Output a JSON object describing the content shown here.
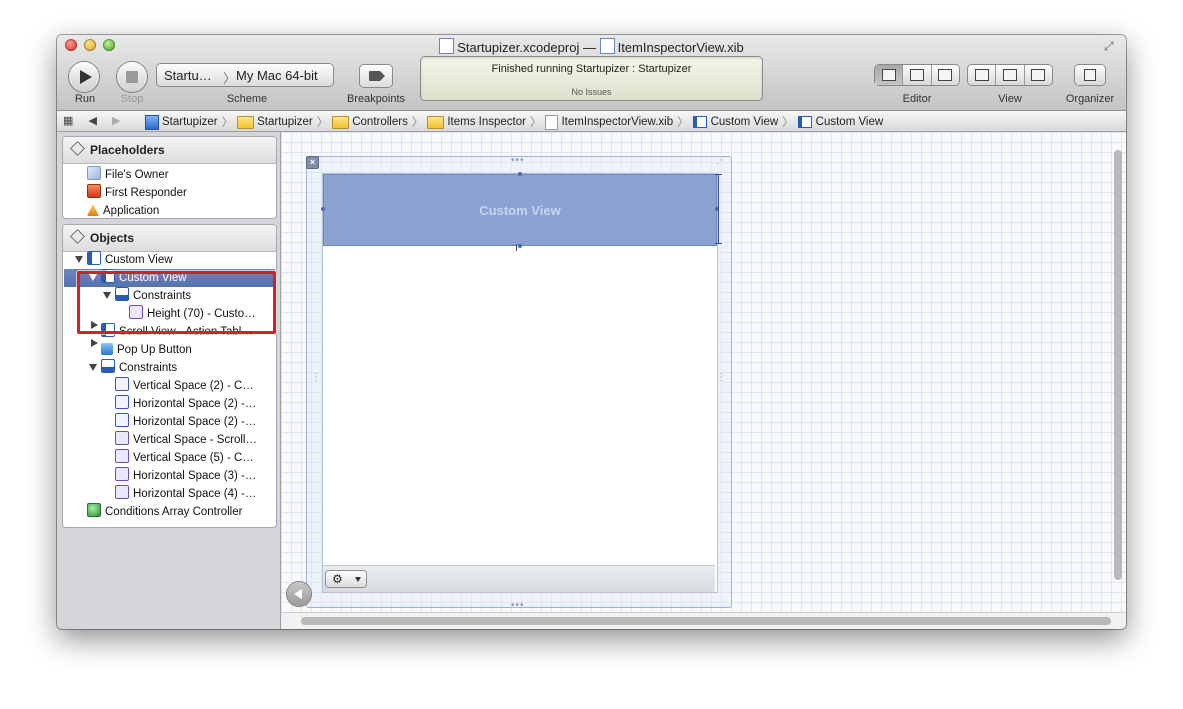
{
  "window": {
    "title_project": "Startupizer.xcodeproj",
    "title_sep": "—",
    "title_file": "ItemInspectorView.xib"
  },
  "toolbar": {
    "run_label": "Run",
    "stop_label": "Stop",
    "scheme_label": "Scheme",
    "scheme_target": "Startu…",
    "scheme_destination": "My Mac 64-bit",
    "breakpoints_label": "Breakpoints",
    "editor_label": "Editor",
    "view_label": "View",
    "organizer_label": "Organizer"
  },
  "activity": {
    "status": "Finished running Startupizer : Startupizer",
    "issues": "No Issues"
  },
  "jumpbar": {
    "items": [
      {
        "label": "Startupizer",
        "icon": "project-icon"
      },
      {
        "label": "Startupizer",
        "icon": "folder-icon"
      },
      {
        "label": "Controllers",
        "icon": "folder-icon"
      },
      {
        "label": "Items Inspector",
        "icon": "folder-icon"
      },
      {
        "label": "ItemInspectorView.xib",
        "icon": "xib-file-icon"
      },
      {
        "label": "Custom View",
        "icon": "view-icon"
      },
      {
        "label": "Custom View",
        "icon": "view-icon"
      }
    ]
  },
  "placeholders": {
    "header": "Placeholders",
    "items": [
      "File's Owner",
      "First Responder",
      "Application"
    ]
  },
  "objects": {
    "header": "Objects",
    "tree": [
      "Custom View",
      "Custom View",
      "Constraints",
      "Height (70) - Custo…",
      "Scroll View - Action Tabl…",
      "Pop Up Button",
      "Constraints",
      "Vertical Space (2) - C…",
      "Horizontal Space (2) -…",
      "Horizontal Space (2) -…",
      "Vertical Space - Scroll…",
      "Vertical Space (5) - C…",
      "Horizontal Space (3) -…",
      "Horizontal Space (4) -…",
      "Conditions Array Controller"
    ]
  },
  "canvas": {
    "custom_view_label": "Custom View",
    "gear_symbol": "⚙"
  },
  "colors": {
    "selection": "#5572ad",
    "highlight_box": "#d3202a",
    "custom_view_fill": "#8aa1d2"
  }
}
